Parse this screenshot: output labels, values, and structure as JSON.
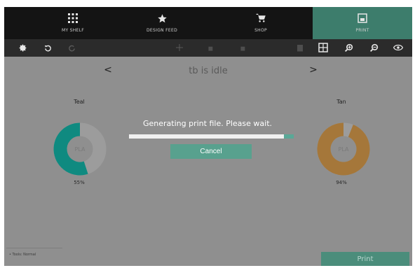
{
  "nav": {
    "tabs": [
      {
        "label": "MY SHELF",
        "icon": "grid-icon"
      },
      {
        "label": "DESIGN FEED",
        "icon": "star-icon"
      },
      {
        "label": "SHOP",
        "icon": "cart-icon"
      },
      {
        "label": "PRINT",
        "icon": "printer-icon",
        "active": true
      }
    ]
  },
  "toolbar": {
    "left_icons": [
      "gear-icon",
      "undo-icon",
      "redo-icon"
    ],
    "center_icons": [
      "move-icon",
      "rotate-icon",
      "scale-icon"
    ],
    "right_icons": [
      "trash-icon",
      "layout-icon",
      "zoom-in-icon",
      "zoom-out-icon",
      "eye-icon"
    ]
  },
  "status": {
    "text": "tb is idle",
    "prev": "<",
    "next": ">"
  },
  "materials": {
    "left": {
      "name": "Teal",
      "type": "PLA",
      "percent": "55%",
      "fill_fraction": 0.55,
      "color": "#0f8a80"
    },
    "right": {
      "name": "Tan",
      "type": "PLA",
      "percent": "94%",
      "fill_fraction": 0.94,
      "color": "#a5773a"
    }
  },
  "dialog": {
    "message": "Generating print file. Please wait.",
    "progress_fraction": 0.95,
    "cancel_label": "Cancel"
  },
  "footer": {
    "status": "• Tools: Normal",
    "print_label": "Print"
  },
  "colors": {
    "accent": "#4b8d7b",
    "background": "#8f8f8f",
    "nav_bg": "#141414",
    "toolbar_bg": "#2b2b2b"
  }
}
